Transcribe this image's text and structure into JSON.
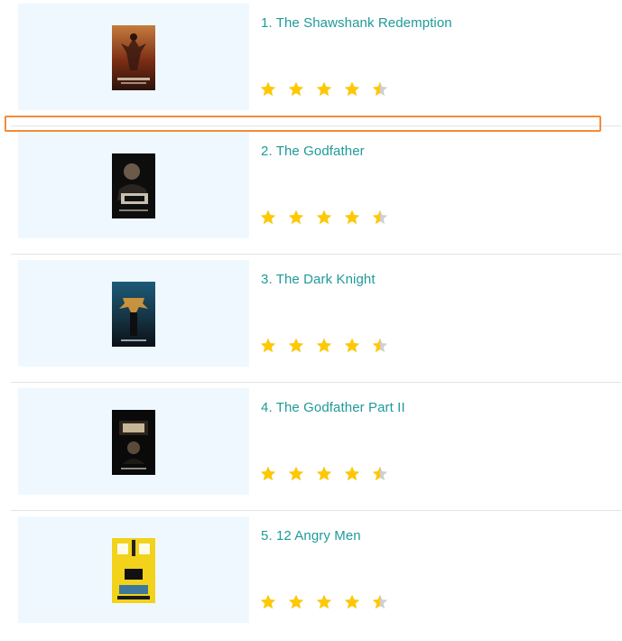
{
  "movies": [
    {
      "title": "1. The Shawshank Redemption",
      "rating": 4.5,
      "poster_icon": "shawshank-poster-icon"
    },
    {
      "title": "2. The Godfather",
      "rating": 4.5,
      "poster_icon": "godfather-poster-icon"
    },
    {
      "title": "3. The Dark Knight",
      "rating": 4.5,
      "poster_icon": "dark-knight-poster-icon"
    },
    {
      "title": "4. The Godfather Part II",
      "rating": 4.5,
      "poster_icon": "godfather-part-ii-poster-icon"
    },
    {
      "title": "5. 12 Angry Men",
      "rating": 4.5,
      "poster_icon": "12-angry-men-poster-icon"
    }
  ],
  "colors": {
    "title": "#1f9a9a",
    "star_filled": "#ffc800",
    "star_empty": "#cfcfcf",
    "poster_background": "#eff8ff",
    "highlight_border": "#f28c3b"
  }
}
